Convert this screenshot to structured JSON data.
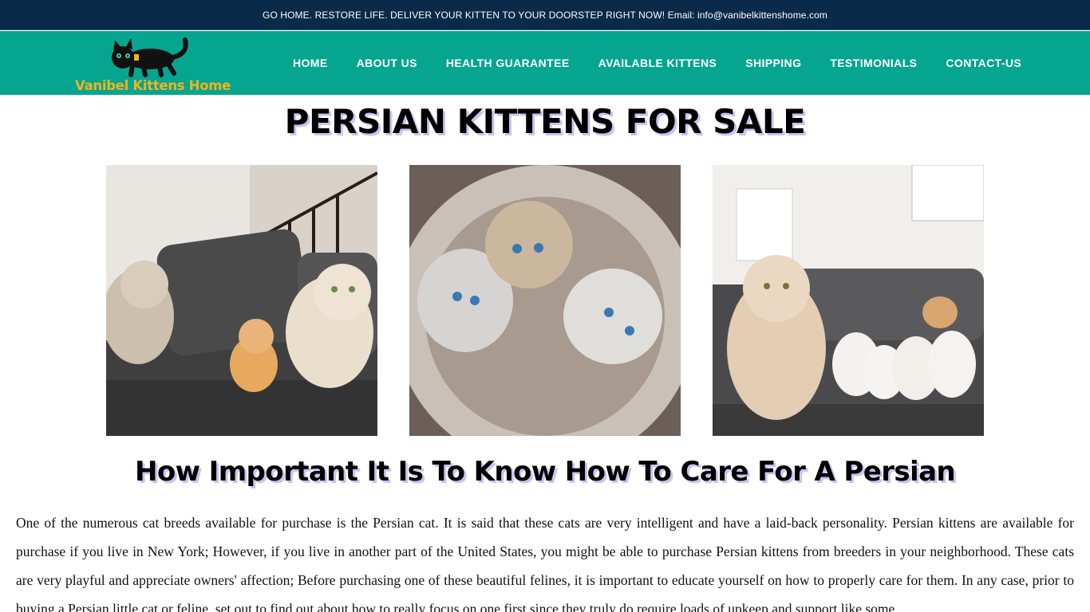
{
  "topbar": {
    "text": "GO HOME. RESTORE LIFE. DELIVER YOUR KITTEN TO YOUR DOORSTEP RIGHT NOW! Email: info@vanibelkittenshome.com"
  },
  "logo": {
    "text": "Vanibel Kittens Home",
    "icon": "black-cat-icon"
  },
  "nav": {
    "items": [
      {
        "label": "HOME"
      },
      {
        "label": "ABOUT US"
      },
      {
        "label": "HEALTH GUARANTEE"
      },
      {
        "label": "AVAILABLE KITTENS"
      },
      {
        "label": "SHIPPING"
      },
      {
        "label": "TESTIMONIALS"
      },
      {
        "label": "CONTACT-US"
      }
    ]
  },
  "main": {
    "title": "PERSIAN KITTENS FOR SALE",
    "heading": "How Important It Is To Know How To Care For A Persian",
    "paragraph": "One of the numerous cat breeds available for purchase is the Persian cat. It is said that these cats are very intelligent and have a laid-back personality. Persian  kittens are available for purchase if you live in New York; However, if you live in another part of the United States, you might be able to purchase Persian  kittens from breeders in your neighborhood. These cats are very playful and appreciate owners' affection; Before purchasing one of these beautiful felines, it is important to educate yourself on how to properly care for them.  In any case, prior to buying a Persian  little cat or feline, set out to find out about how to really focus on one first since they truly do require loads of upkeep and support like some"
  },
  "colors": {
    "topbar": "#0a2a4a",
    "navbar": "#06a58f",
    "logo_text": "#f2b31d",
    "title_shadow": "#c9c4f0"
  }
}
